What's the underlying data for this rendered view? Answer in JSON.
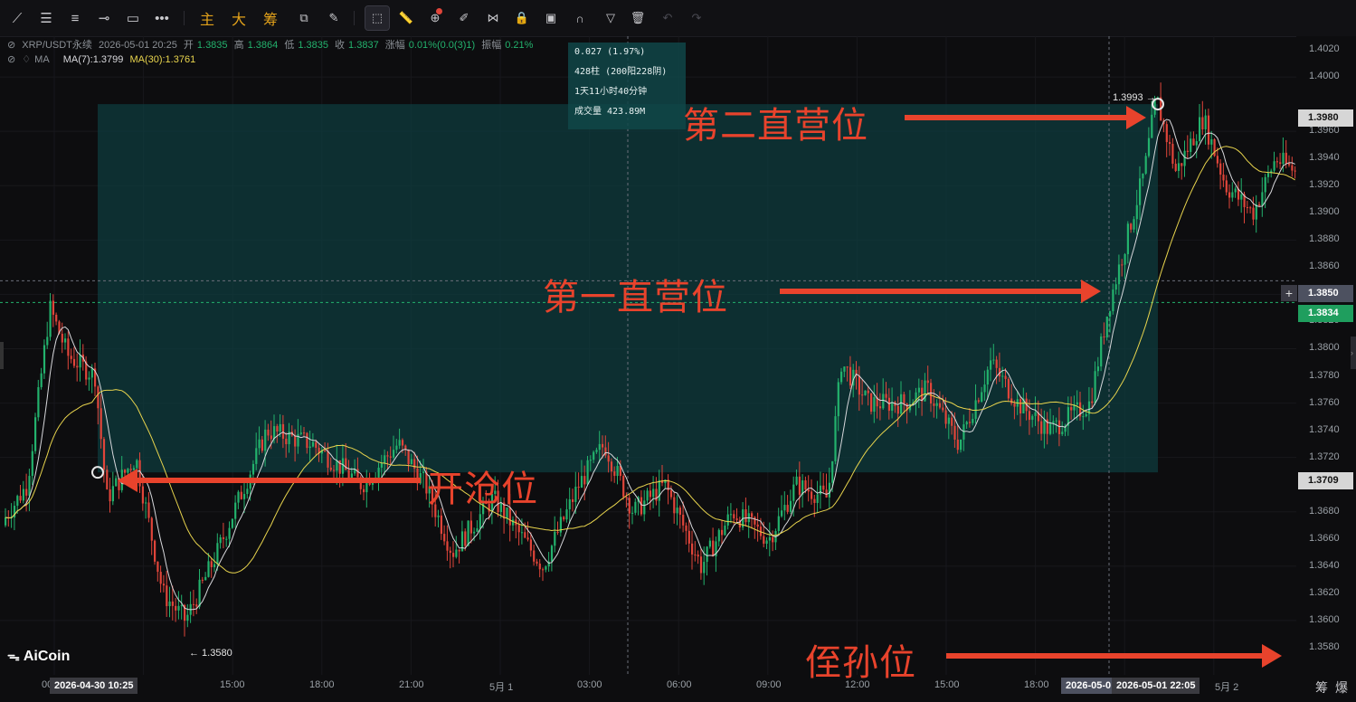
{
  "toolbar": {
    "tools": [
      {
        "name": "line-tool-icon",
        "glyph": "⟋"
      },
      {
        "name": "parallel-lines-icon",
        "glyph": "☰"
      },
      {
        "name": "horizontal-lines-icon",
        "glyph": "≡"
      },
      {
        "name": "horizontal-ray-icon",
        "glyph": "⊸"
      },
      {
        "name": "rectangle-icon",
        "glyph": "▭"
      },
      {
        "name": "more-tools-icon",
        "glyph": "•••"
      }
    ],
    "cn_buttons": [
      "主",
      "大",
      "筹"
    ],
    "tools2": [
      {
        "name": "measure-icon",
        "glyph": "⧉"
      },
      {
        "name": "draw-tool-icon",
        "glyph": "✎"
      },
      {
        "name": "price-range-icon",
        "glyph": "⬚"
      },
      {
        "name": "ruler-icon",
        "glyph": "📏"
      },
      {
        "name": "zoom-icon",
        "glyph": "⊕"
      },
      {
        "name": "eraser-icon",
        "glyph": "✐"
      },
      {
        "name": "pattern-icon",
        "glyph": "⋈"
      },
      {
        "name": "lock-icon",
        "glyph": "🔒"
      },
      {
        "name": "visibility-icon",
        "glyph": "▣"
      },
      {
        "name": "magnet-icon",
        "glyph": "∩"
      },
      {
        "name": "filter-icon",
        "glyph": "▽"
      },
      {
        "name": "delete-icon",
        "glyph": "🗑"
      },
      {
        "name": "undo-icon",
        "glyph": "↶"
      },
      {
        "name": "redo-icon",
        "glyph": "↷"
      }
    ]
  },
  "info": {
    "symbol": "XRP/USDT永续",
    "datetime": "2026-05-01 20:25",
    "open_label": "开",
    "open": "1.3835",
    "high_label": "高",
    "high": "1.3864",
    "low_label": "低",
    "low": "1.3835",
    "close_label": "收",
    "close": "1.3837",
    "change_label": "涨幅",
    "change": "0.01%(0.0(3)1)",
    "amplitude_label": "振幅",
    "amplitude": "0.21%",
    "ma_label": "MA",
    "ma7": "MA(7):1.3799",
    "ma30": "MA(30):1.3761"
  },
  "tooltip": {
    "line1": "0.027 (1.97%)",
    "line2": "428柱 (200阳228阴)",
    "line3": "1天11小时40分钟",
    "line4": "成交量 423.89M"
  },
  "price_axis": {
    "labels": [
      "1.4020",
      "1.4000",
      "1.3960",
      "1.3940",
      "1.3920",
      "1.3900",
      "1.3880",
      "1.3860",
      "1.3820",
      "1.3800",
      "1.3780",
      "1.3760",
      "1.3740",
      "1.3720",
      "1.3700",
      "1.3680",
      "1.3660",
      "1.3640",
      "1.3620",
      "1.3600",
      "1.3580"
    ],
    "tag_high": "1.3980",
    "tag_cross": "1.3850",
    "tag_last": "1.3834",
    "tag_low": "1.3709"
  },
  "time_axis": {
    "labels": [
      "00",
      "15:00",
      "18:00",
      "21:00",
      "5月 1",
      "03:00",
      "06:00",
      "09:00",
      "12:00",
      "15:00",
      "18:00",
      "5月 2"
    ],
    "tag_start": "2026-04-30 10:25",
    "tag_mid": "2026-05-0",
    "tag_end": "2026-05-01 22:05"
  },
  "marks": {
    "high_label": "1.3993 →",
    "low_label": "← 1.3580"
  },
  "annotations": {
    "second": "第二直营位",
    "first": "第一直营位",
    "open": "开沧位",
    "stop": "侄孙位"
  },
  "logo": "AiCoin",
  "corner": [
    "筹",
    "爆"
  ],
  "colors": {
    "up": "#23b26d",
    "down": "#e0453a",
    "ma7": "#d8d8dc",
    "ma30": "#e8d44d",
    "range_fill": "#0e3b3d",
    "arrow": "#e8432c"
  },
  "chart_data": {
    "type": "candlestick",
    "ylim": [
      1.356,
      1.403
    ],
    "open_price": 1.3709,
    "high_mark": 1.3993,
    "low_mark": 1.358,
    "last_price": 1.3834
  }
}
